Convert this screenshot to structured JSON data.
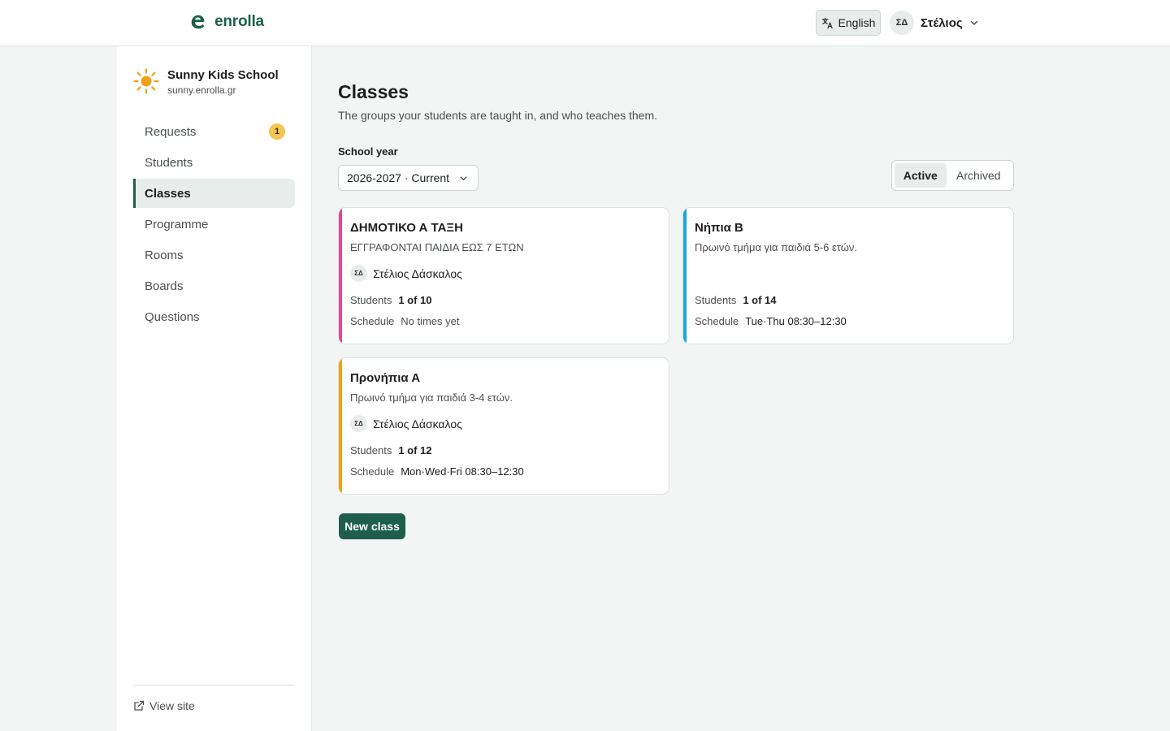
{
  "app": {
    "brand_name": "enrolla",
    "brand_color": "#1d5f4a"
  },
  "header": {
    "language_label": "English",
    "user_initials": "ΣΔ",
    "user_name": "Στέλιος"
  },
  "sidebar": {
    "school_name": "Sunny Kids School",
    "school_domain": "sunny.enrolla.gr",
    "items": [
      {
        "label": "Requests",
        "badge": "1",
        "active": false
      },
      {
        "label": "Students",
        "active": false
      },
      {
        "label": "Classes",
        "active": true
      },
      {
        "label": "Programme",
        "active": false
      },
      {
        "label": "Rooms",
        "active": false
      },
      {
        "label": "Boards",
        "active": false
      },
      {
        "label": "Questions",
        "active": false
      }
    ],
    "view_site_label": "View site"
  },
  "main": {
    "title": "Classes",
    "subtitle": "The groups your students are taught in, and who teaches them.",
    "school_year_label": "School year",
    "school_year_value": "2026-2027 · Current",
    "filter": {
      "active_label": "Active",
      "archived_label": "Archived",
      "selected": "Active"
    },
    "labels": {
      "students": "Students",
      "schedule": "Schedule"
    },
    "classes": [
      {
        "name": "ΔΗΜΟΤΙΚΟ Α ΤΑΞΗ",
        "description": "ΕΓΓΡΑΦΟΝΤΑΙ ΠΑΙΔΙΑ ΕΩΣ 7 ΕΤΩΝ",
        "teacher_initials": "ΣΔ",
        "teacher_name": "Στέλιος Δάσκαλος",
        "students": "1 of 10",
        "schedule": "No times yet",
        "accent_color": "#e0489a"
      },
      {
        "name": "Νήπια Β",
        "description": "Πρωινό τμήμα για παιδιά 5-6 ετών.",
        "students": "1 of 14",
        "schedule": "Tue·Thu 08:30–12:30",
        "accent_color": "#1ba6e6"
      },
      {
        "name": "Προνήπια Α",
        "description": "Πρωινό τμήμα για παιδιά 3-4 ετών.",
        "teacher_initials": "ΣΔ",
        "teacher_name": "Στέλιος Δάσκαλος",
        "students": "1 of 12",
        "schedule": "Mon·Wed·Fri 08:30–12:30",
        "accent_color": "#f0a11a"
      }
    ],
    "new_class_label": "New class"
  },
  "icons": {
    "brand": "enrolla-logo-icon",
    "language": "translate-icon",
    "user_menu": "chevron-down-icon",
    "school": "sun-icon",
    "year_select": "chevron-down-icon",
    "view_site": "external-link-icon"
  }
}
